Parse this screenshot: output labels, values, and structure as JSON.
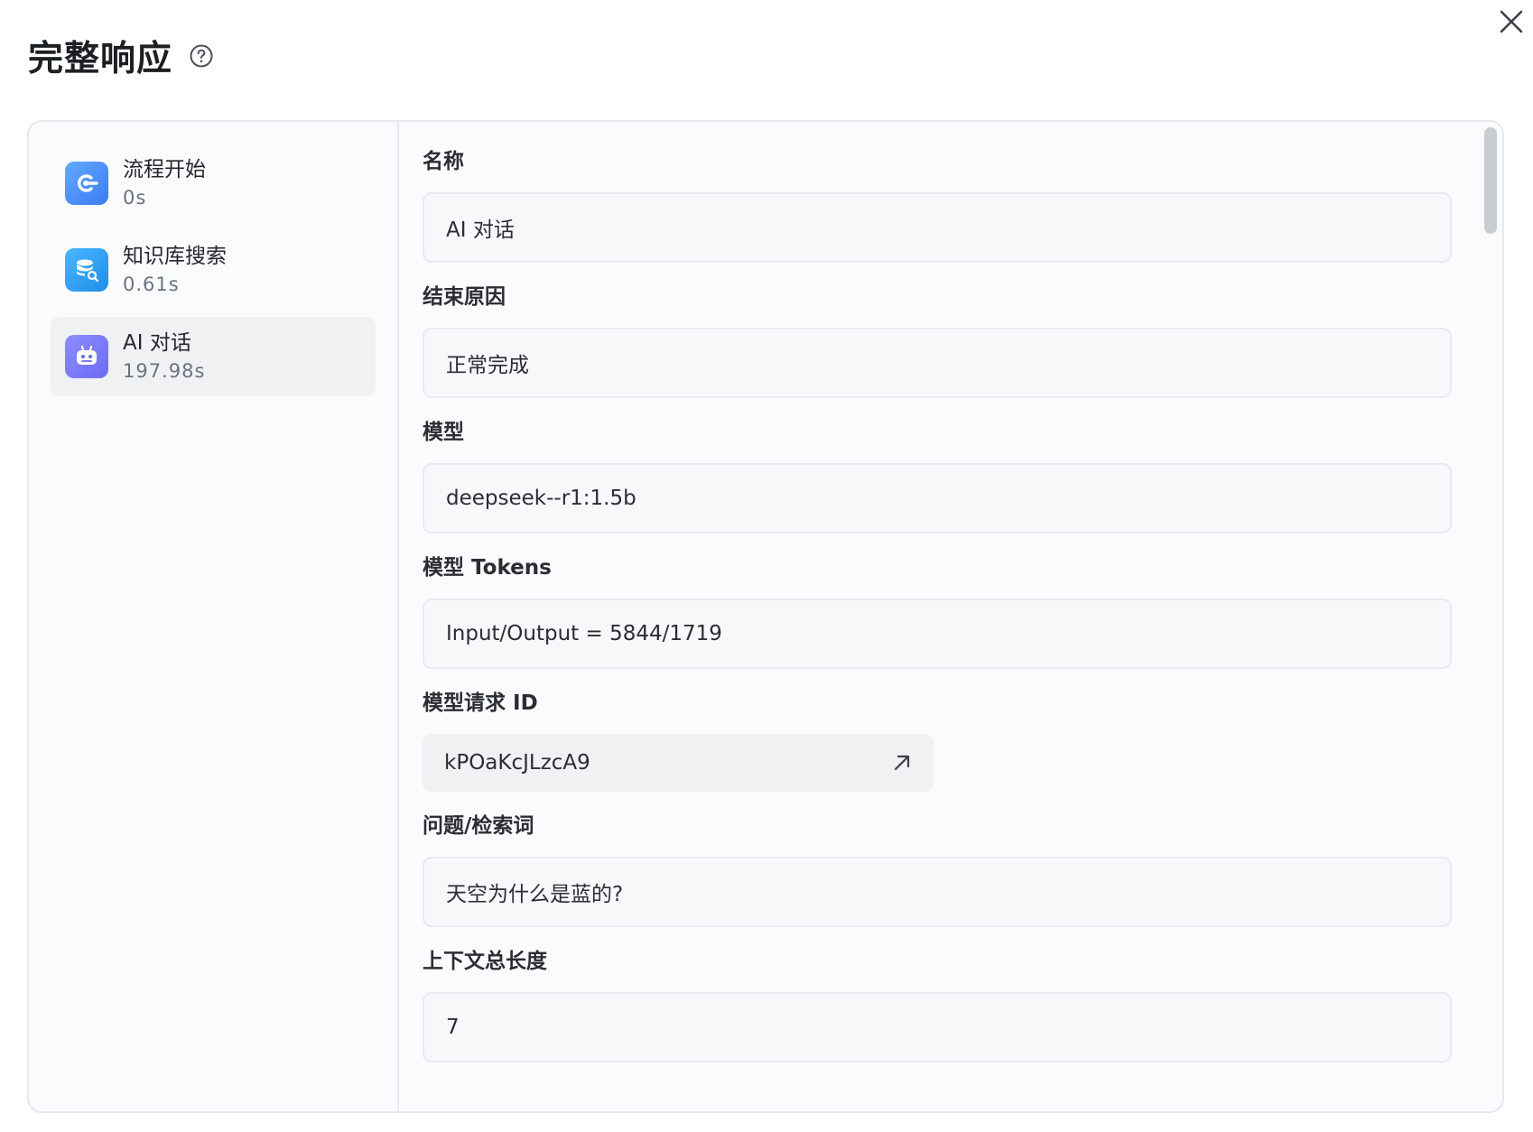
{
  "header": {
    "title": "完整响应"
  },
  "sidebar": {
    "nodes": [
      {
        "name": "流程开始",
        "time": "0s",
        "icon": "flow-start-icon"
      },
      {
        "name": "知识库搜索",
        "time": "0.61s",
        "icon": "knowledge-search-icon"
      },
      {
        "name": "AI 对话",
        "time": "197.98s",
        "icon": "robot-icon"
      }
    ],
    "active_index": 2
  },
  "detail": {
    "fields": [
      {
        "label": "名称",
        "value": "AI 对话"
      },
      {
        "label": "结束原因",
        "value": "正常完成"
      },
      {
        "label": "模型",
        "value": "deepseek--r1:1.5b"
      },
      {
        "label": "模型 Tokens",
        "value": "Input/Output = 5844/1719"
      },
      {
        "label": "模型请求 ID",
        "value": "kPOaKcJLzcA9"
      },
      {
        "label": "问题/检索词",
        "value": "天空为什么是蓝的?"
      },
      {
        "label": "上下文总长度",
        "value": "7"
      }
    ]
  },
  "colors": {
    "accent_blue": "#3a7cf2",
    "accent_purple": "#6b6bf4",
    "panel_bg": "#fafbfc",
    "border": "#e6e9ec"
  }
}
